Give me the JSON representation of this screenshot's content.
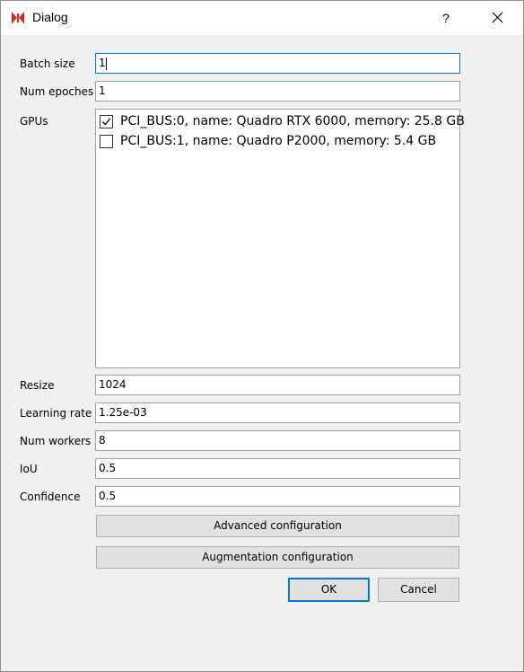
{
  "window": {
    "title": "Dialog",
    "help_label": "?",
    "icons": {
      "app": "app-logo-icon",
      "close": "close-icon",
      "check": "checkmark-icon"
    },
    "colors": {
      "accent": "#0078d7",
      "app_icon": "#d52b1e"
    }
  },
  "form": {
    "batch_size": {
      "label": "Batch size",
      "value": "1"
    },
    "num_epochs": {
      "label": "Num epoches",
      "value": "1"
    },
    "gpus": {
      "label": "GPUs",
      "items": [
        {
          "text": "PCI_BUS:0, name: Quadro RTX 6000, memory: 25.8 GB",
          "checked": true
        },
        {
          "text": "PCI_BUS:1, name: Quadro P2000, memory: 5.4 GB",
          "checked": false
        }
      ]
    },
    "resize": {
      "label": "Resize",
      "value": "1024"
    },
    "learning_rate": {
      "label": "Learning rate",
      "value": "1.25e-03"
    },
    "num_workers": {
      "label": "Num workers",
      "value": "8"
    },
    "iou": {
      "label": "IoU",
      "value": "0.5"
    },
    "confidence": {
      "label": "Confidence",
      "value": "0.5"
    }
  },
  "buttons": {
    "advanced": "Advanced configuration",
    "augmentation": "Augmentation configuration",
    "ok": "OK",
    "cancel": "Cancel"
  }
}
